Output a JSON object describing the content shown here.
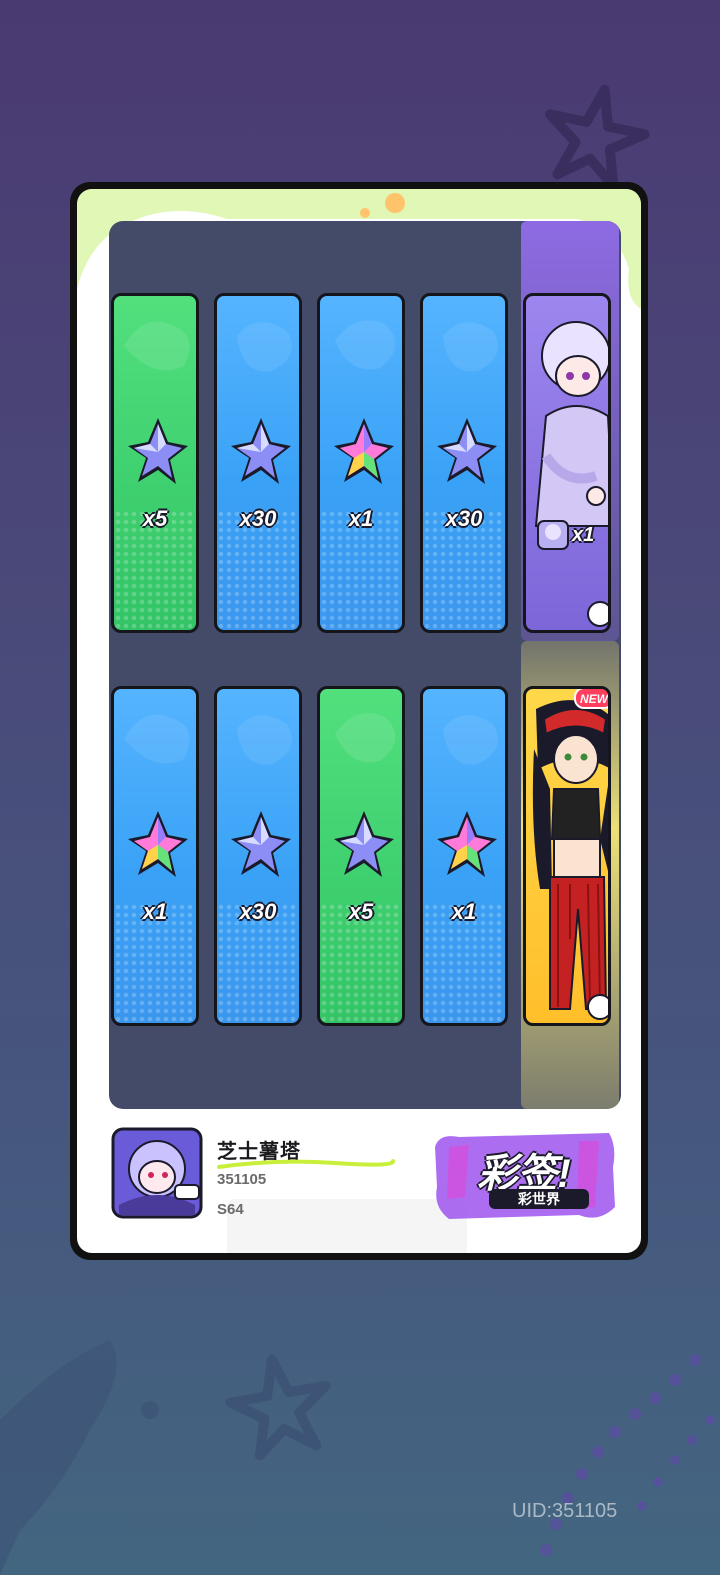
{
  "cards": [
    {
      "color": "green",
      "star": "blue-star-icon",
      "qty": "x5"
    },
    {
      "color": "blue",
      "star": "blue-star-icon",
      "qty": "x30"
    },
    {
      "color": "blue",
      "star": "rainbow-star-icon",
      "qty": "x1"
    },
    {
      "color": "blue",
      "star": "blue-star-icon",
      "qty": "x30"
    },
    {
      "color": "blue",
      "star": "rainbow-star-icon",
      "qty": "x1"
    },
    {
      "color": "blue",
      "star": "blue-star-icon",
      "qty": "x30"
    },
    {
      "color": "green",
      "star": "blue-star-icon",
      "qty": "x5"
    },
    {
      "color": "blue",
      "star": "rainbow-star-icon",
      "qty": "x1"
    }
  ],
  "special_cards": [
    {
      "theme": "purple",
      "qty": "x1",
      "chip": "紫头像"
    },
    {
      "theme": "yellow",
      "badge": "NEW"
    }
  ],
  "profile": {
    "name": "芝士薯塔",
    "number": "351105",
    "season": "S64"
  },
  "logo": {
    "main": "彩签!",
    "sub": "彩世界"
  },
  "uid_label": "UID:351105",
  "colors": {
    "blue_card": "#3aa2f6",
    "green_card": "#3fd070",
    "purple_card": "#8a72e0",
    "yellow_card": "#ffc52f",
    "frame": "#111111"
  }
}
